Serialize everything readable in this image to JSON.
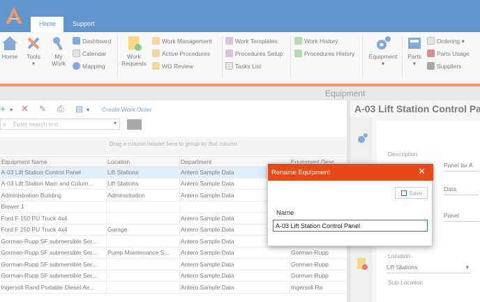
{
  "app": {
    "tabs": [
      {
        "label": "Home"
      },
      {
        "label": "Support"
      }
    ]
  },
  "ribbon": {
    "home": "Home",
    "tools": "Tools",
    "my_work": "My\nWork",
    "dashboard": "Dashboard",
    "calendar": "Calendar",
    "mapping": "Mapping",
    "work_requests": "Work\nRequests",
    "work_management": "Work Management",
    "active_procedures": "Active Procedures",
    "wo_review": "WO Review",
    "work_templates": "Work Templates",
    "procedures_setup": "Procedures Setup",
    "tasks_list": "Tasks List",
    "work_history": "Work History",
    "procedures_history": "Procedures History",
    "equipment": "Equipment",
    "parts": "Parts",
    "ordering": "Ordering",
    "parts_usage": "Parts Usage",
    "suppliers": "Suppliers"
  },
  "section_title": "Equipment",
  "toolbar": {
    "create_work_order": "Create Work Order",
    "search_placeholder": "Enter search text"
  },
  "group_hint": "Drag a column header here to group by that column",
  "grid": {
    "columns": [
      "Equipment Name",
      "Location",
      "Department",
      "Equipment Desc"
    ],
    "rows": [
      [
        "A-03 Lift Station Control Panel",
        "Lift Stations",
        "Antero Sample Data",
        ""
      ],
      [
        "A-03 Lift Station Main and Colum...",
        "Lift Stations",
        "Antero Sample Data",
        ""
      ],
      [
        "Administration Building",
        "Administration",
        "Antero Sample Data",
        ""
      ],
      [
        "Blower 1",
        "",
        "",
        ""
      ],
      [
        "Ford F 150 PU Truck 4x4",
        "",
        "Antero Sample Data",
        ""
      ],
      [
        "Ford F 250 PU Truck 4x4",
        "Garage",
        "Antero Sample Data",
        ""
      ],
      [
        "Gorman-Rupp SF submersible Ser...",
        "",
        "Antero Sample Data",
        ""
      ],
      [
        "Gorman-Rupp SF submersible Ser...",
        "Pump Maintenance S...",
        "Antero Sample Data",
        "Gorman-Rupp"
      ],
      [
        "Gorman-Rupp SF submersible Ser...",
        "",
        "Antero Sample Data",
        "Gorman-Rupp"
      ],
      [
        "Gorman-Rupp SF submersible Ser...",
        "",
        "Antero Sample Data",
        "Gorman-Rupp"
      ],
      [
        "Ingersoll Rand Portable Diesel Air...",
        "",
        "Antero Sample Data",
        "Ingersoll Ra"
      ]
    ]
  },
  "detail": {
    "title": "A-03 Lift Station Control Pa",
    "description_label": "Description",
    "description_value": "Panel for A",
    "field2_value": "Data",
    "field3_value": "Panel",
    "location_label": "Location",
    "location_value": "Lift Stations",
    "sublocation_label": "Sub-Location"
  },
  "dialog": {
    "title": "Rename Equipment",
    "save_label": "Save",
    "name_label": "Name",
    "name_value": "A-03 Lift Station Control Panel"
  },
  "colors": {
    "brand_blue": "#0b5cb3",
    "accent_orange": "#e8491a",
    "selection": "#cfe3f8"
  }
}
